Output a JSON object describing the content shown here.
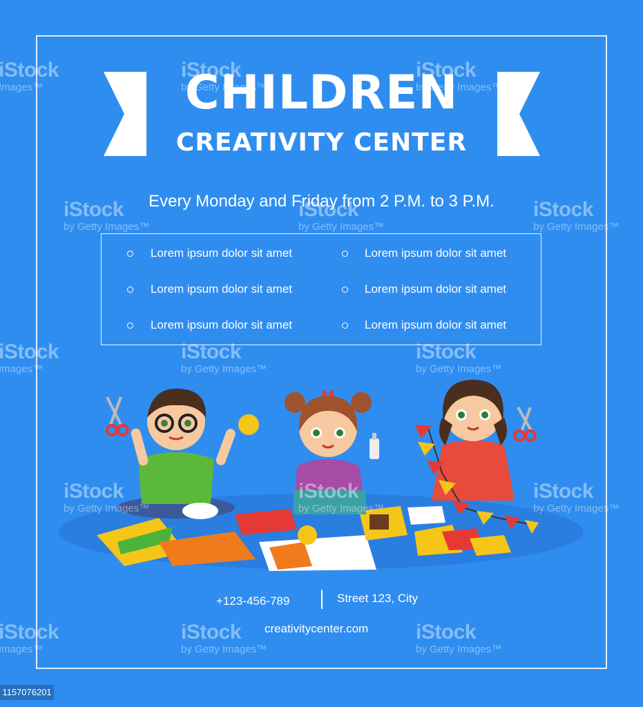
{
  "title": "CHILDREN",
  "subtitle": "CREATIVITY CENTER",
  "schedule": "Every Monday and Friday from 2 P.M. to  3 P.M.",
  "features": [
    "Lorem ipsum dolor sit amet",
    "Lorem ipsum dolor sit amet",
    "Lorem ipsum dolor sit amet",
    "Lorem ipsum dolor sit amet",
    "Lorem ipsum dolor sit amet",
    "Lorem ipsum dolor sit amet"
  ],
  "contact": {
    "phone": "+123-456-789",
    "address": "Street 123, City",
    "website": "creativitycenter.com"
  },
  "watermark": {
    "brand": "iStock",
    "credit": "by Getty Images™",
    "credit_short": "Images™"
  },
  "image_id": "1157076201",
  "colors": {
    "background": "#2f8df0",
    "text": "#ffffff"
  }
}
